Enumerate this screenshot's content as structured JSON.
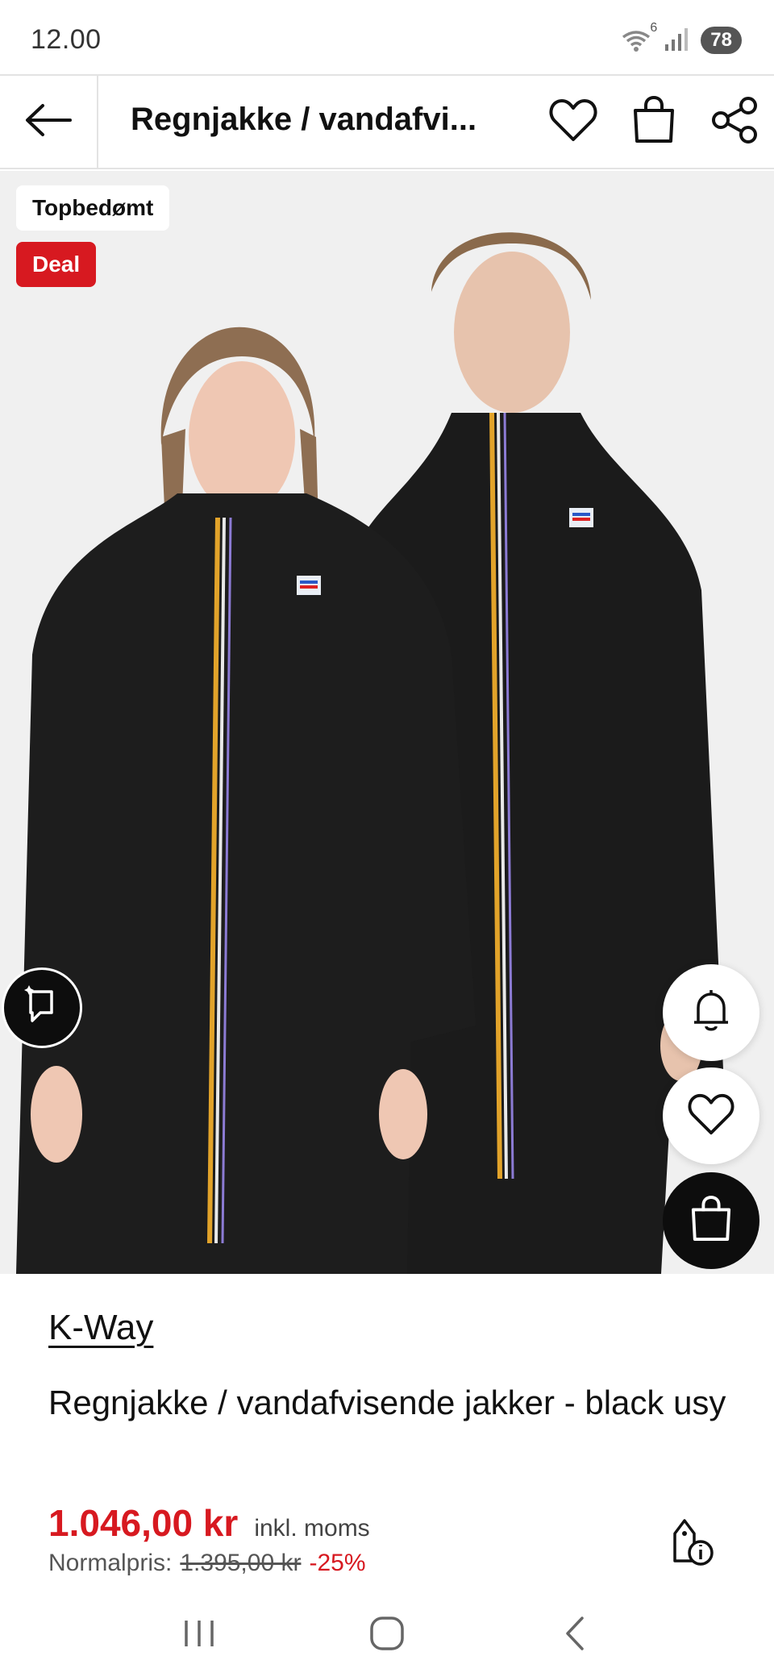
{
  "status_bar": {
    "time": "12.00",
    "wifi_label": "6",
    "battery": "78",
    "icons": [
      "wifi-icon",
      "signal-icon",
      "battery-icon"
    ]
  },
  "header": {
    "title": "Regnjakke / vandafvi...",
    "back_icon": "arrow-left-icon",
    "wishlist_icon": "heart-icon",
    "bag_icon": "shopping-bag-icon",
    "share_icon": "share-icon"
  },
  "image": {
    "badge_top": "Topbedømt",
    "badge_deal": "Deal",
    "colors": {
      "deal_badge": "#d71920",
      "background": "#f0f0f0",
      "jacket": "#1a1a1a"
    },
    "lens_icon": "visual-search-icon",
    "notify_icon": "bell-icon",
    "favorite_icon": "heart-icon",
    "add_to_bag_icon": "shopping-bag-icon"
  },
  "product": {
    "brand": "K-Way",
    "name": "Regnjakke / vandafvisende jakker - black usy",
    "price": "1.046,00 kr",
    "vat_note": "inkl. moms",
    "normal_label": "Normalpris:",
    "normal_price": "1.395,00 kr",
    "discount": "-25%",
    "price_info_icon": "price-tag-info-icon",
    "colors": {
      "price": "#d71920"
    }
  },
  "nav": {
    "icons": [
      "recent-apps-icon",
      "home-icon",
      "back-icon"
    ]
  }
}
